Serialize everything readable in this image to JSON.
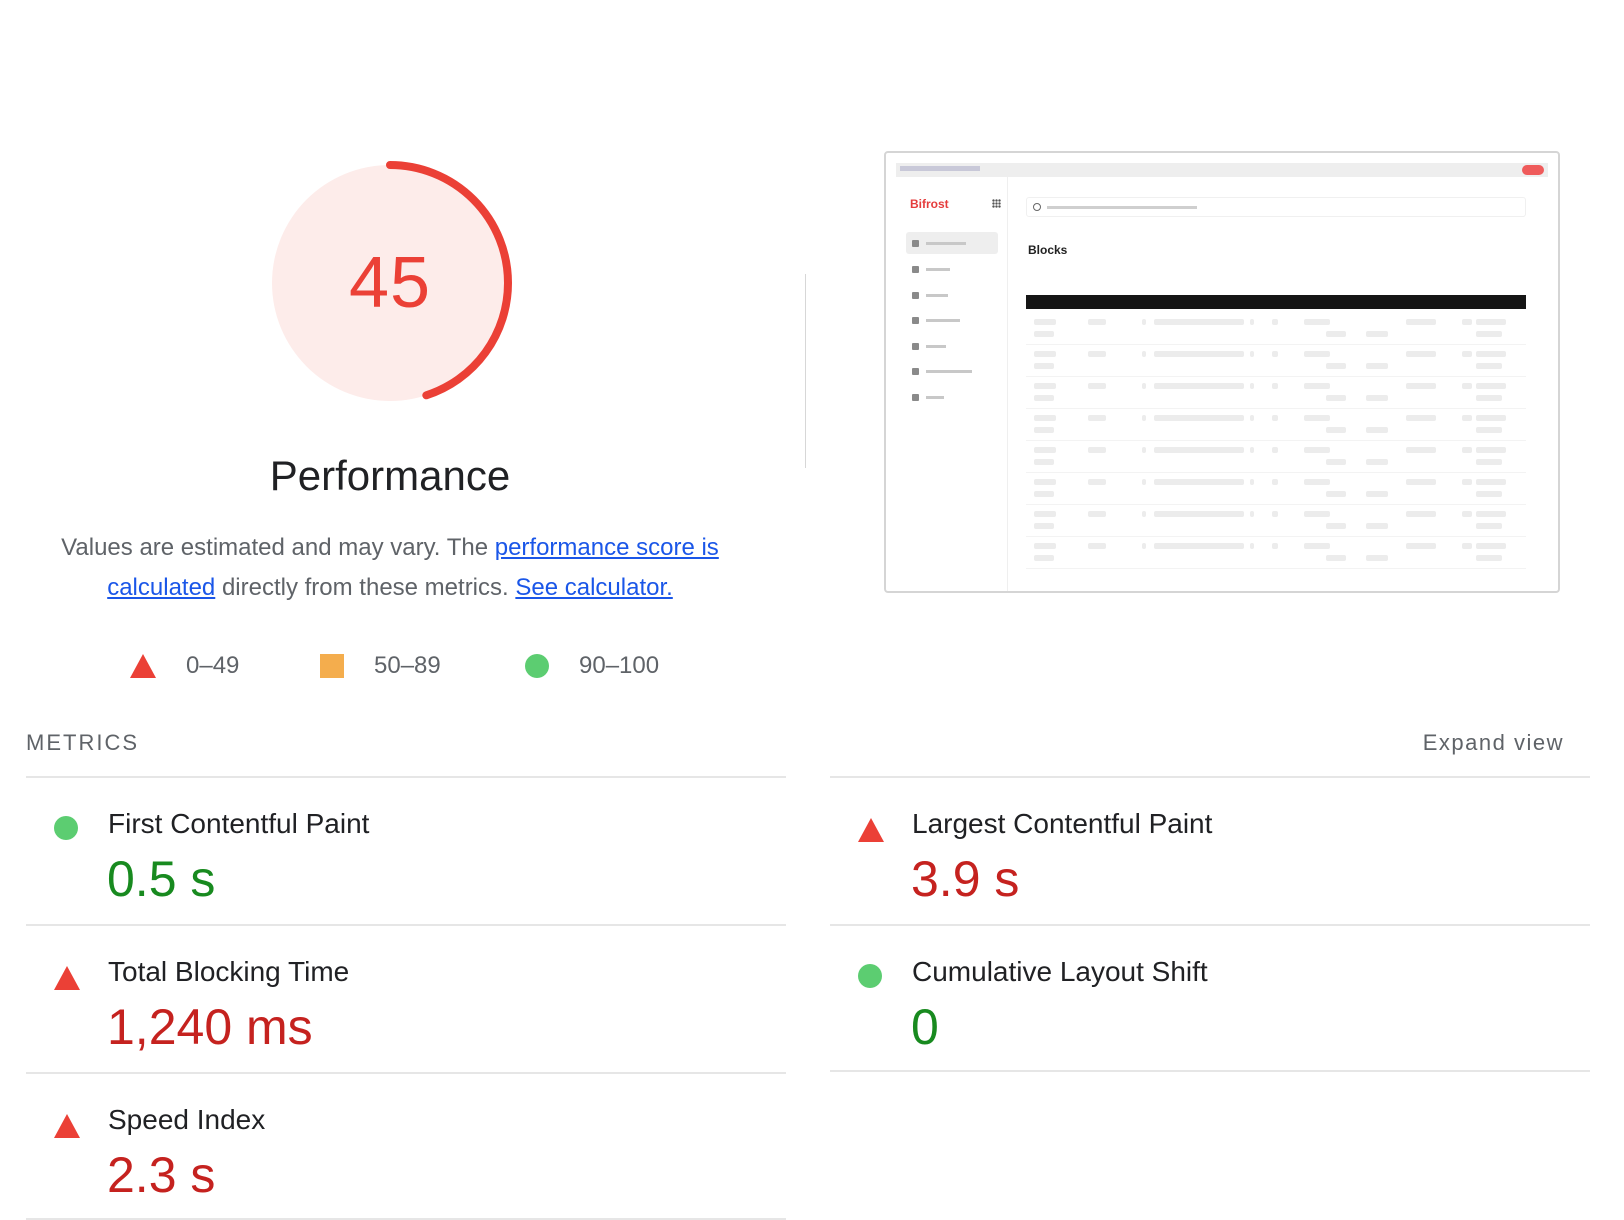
{
  "score": {
    "value": "45",
    "fraction": 0.45,
    "color": "#eb4036",
    "bg": "#fdecea"
  },
  "category": {
    "title": "Performance"
  },
  "description": {
    "prefix": "Values are estimated and may vary. The ",
    "link1": "performance score is calculated",
    "middle": " directly from these metrics. ",
    "link2": "See calculator."
  },
  "legend": [
    {
      "shape": "triangle",
      "label": "0–49",
      "color": "#eb4036"
    },
    {
      "shape": "square",
      "label": "50–89",
      "color": "#f4ad4d"
    },
    {
      "shape": "circle",
      "label": "90–100",
      "color": "#5ccd71"
    }
  ],
  "thumbnail": {
    "logo": "Bifrost",
    "page_heading": "Blocks"
  },
  "metrics_section": {
    "title": "METRICS",
    "expand_label": "Expand view"
  },
  "metrics": [
    {
      "name": "First Contentful Paint",
      "value": "0.5 s",
      "status": "good"
    },
    {
      "name": "Largest Contentful Paint",
      "value": "3.9 s",
      "status": "bad"
    },
    {
      "name": "Total Blocking Time",
      "value": "1,240 ms",
      "status": "bad"
    },
    {
      "name": "Cumulative Layout Shift",
      "value": "0",
      "status": "good"
    },
    {
      "name": "Speed Index",
      "value": "2.3 s",
      "status": "bad"
    }
  ]
}
